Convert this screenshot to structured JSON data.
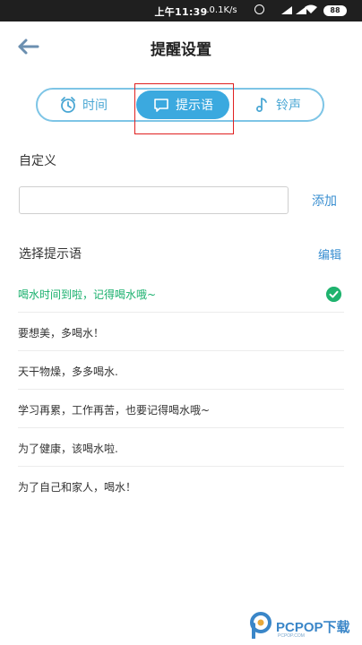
{
  "status_bar": {
    "time": "上午11:39",
    "network_speed": "...0.1K/s",
    "battery": "88"
  },
  "header": {
    "title": "提醒设置"
  },
  "tabs": [
    {
      "label": "时间",
      "icon": "alarm-clock-icon",
      "selected": false
    },
    {
      "label": "提示语",
      "icon": "message-icon",
      "selected": true
    },
    {
      "label": "铃声",
      "icon": "music-note-icon",
      "selected": false
    }
  ],
  "custom": {
    "label": "自定义",
    "input_value": "",
    "add_label": "添加"
  },
  "select": {
    "label": "选择提示语",
    "edit_label": "编辑"
  },
  "tips": [
    {
      "text": "喝水时间到啦，记得喝水哦~",
      "selected": true
    },
    {
      "text": "要想美，多喝水！",
      "selected": false
    },
    {
      "text": "天干物燥，多多喝水.",
      "selected": false
    },
    {
      "text": "学习再累，工作再苦，也要记得喝水哦~",
      "selected": false
    },
    {
      "text": "为了健康，该喝水啦.",
      "selected": false
    },
    {
      "text": "为了自己和家人，喝水！",
      "selected": false
    }
  ],
  "colors": {
    "accent": "#3ba9df",
    "selected_text": "#19b06d",
    "link": "#3a8fd1",
    "highlight_box": "#e02020"
  },
  "watermark": {
    "brand": "PCPOP下载",
    "sub": "PCPOP.COM"
  }
}
